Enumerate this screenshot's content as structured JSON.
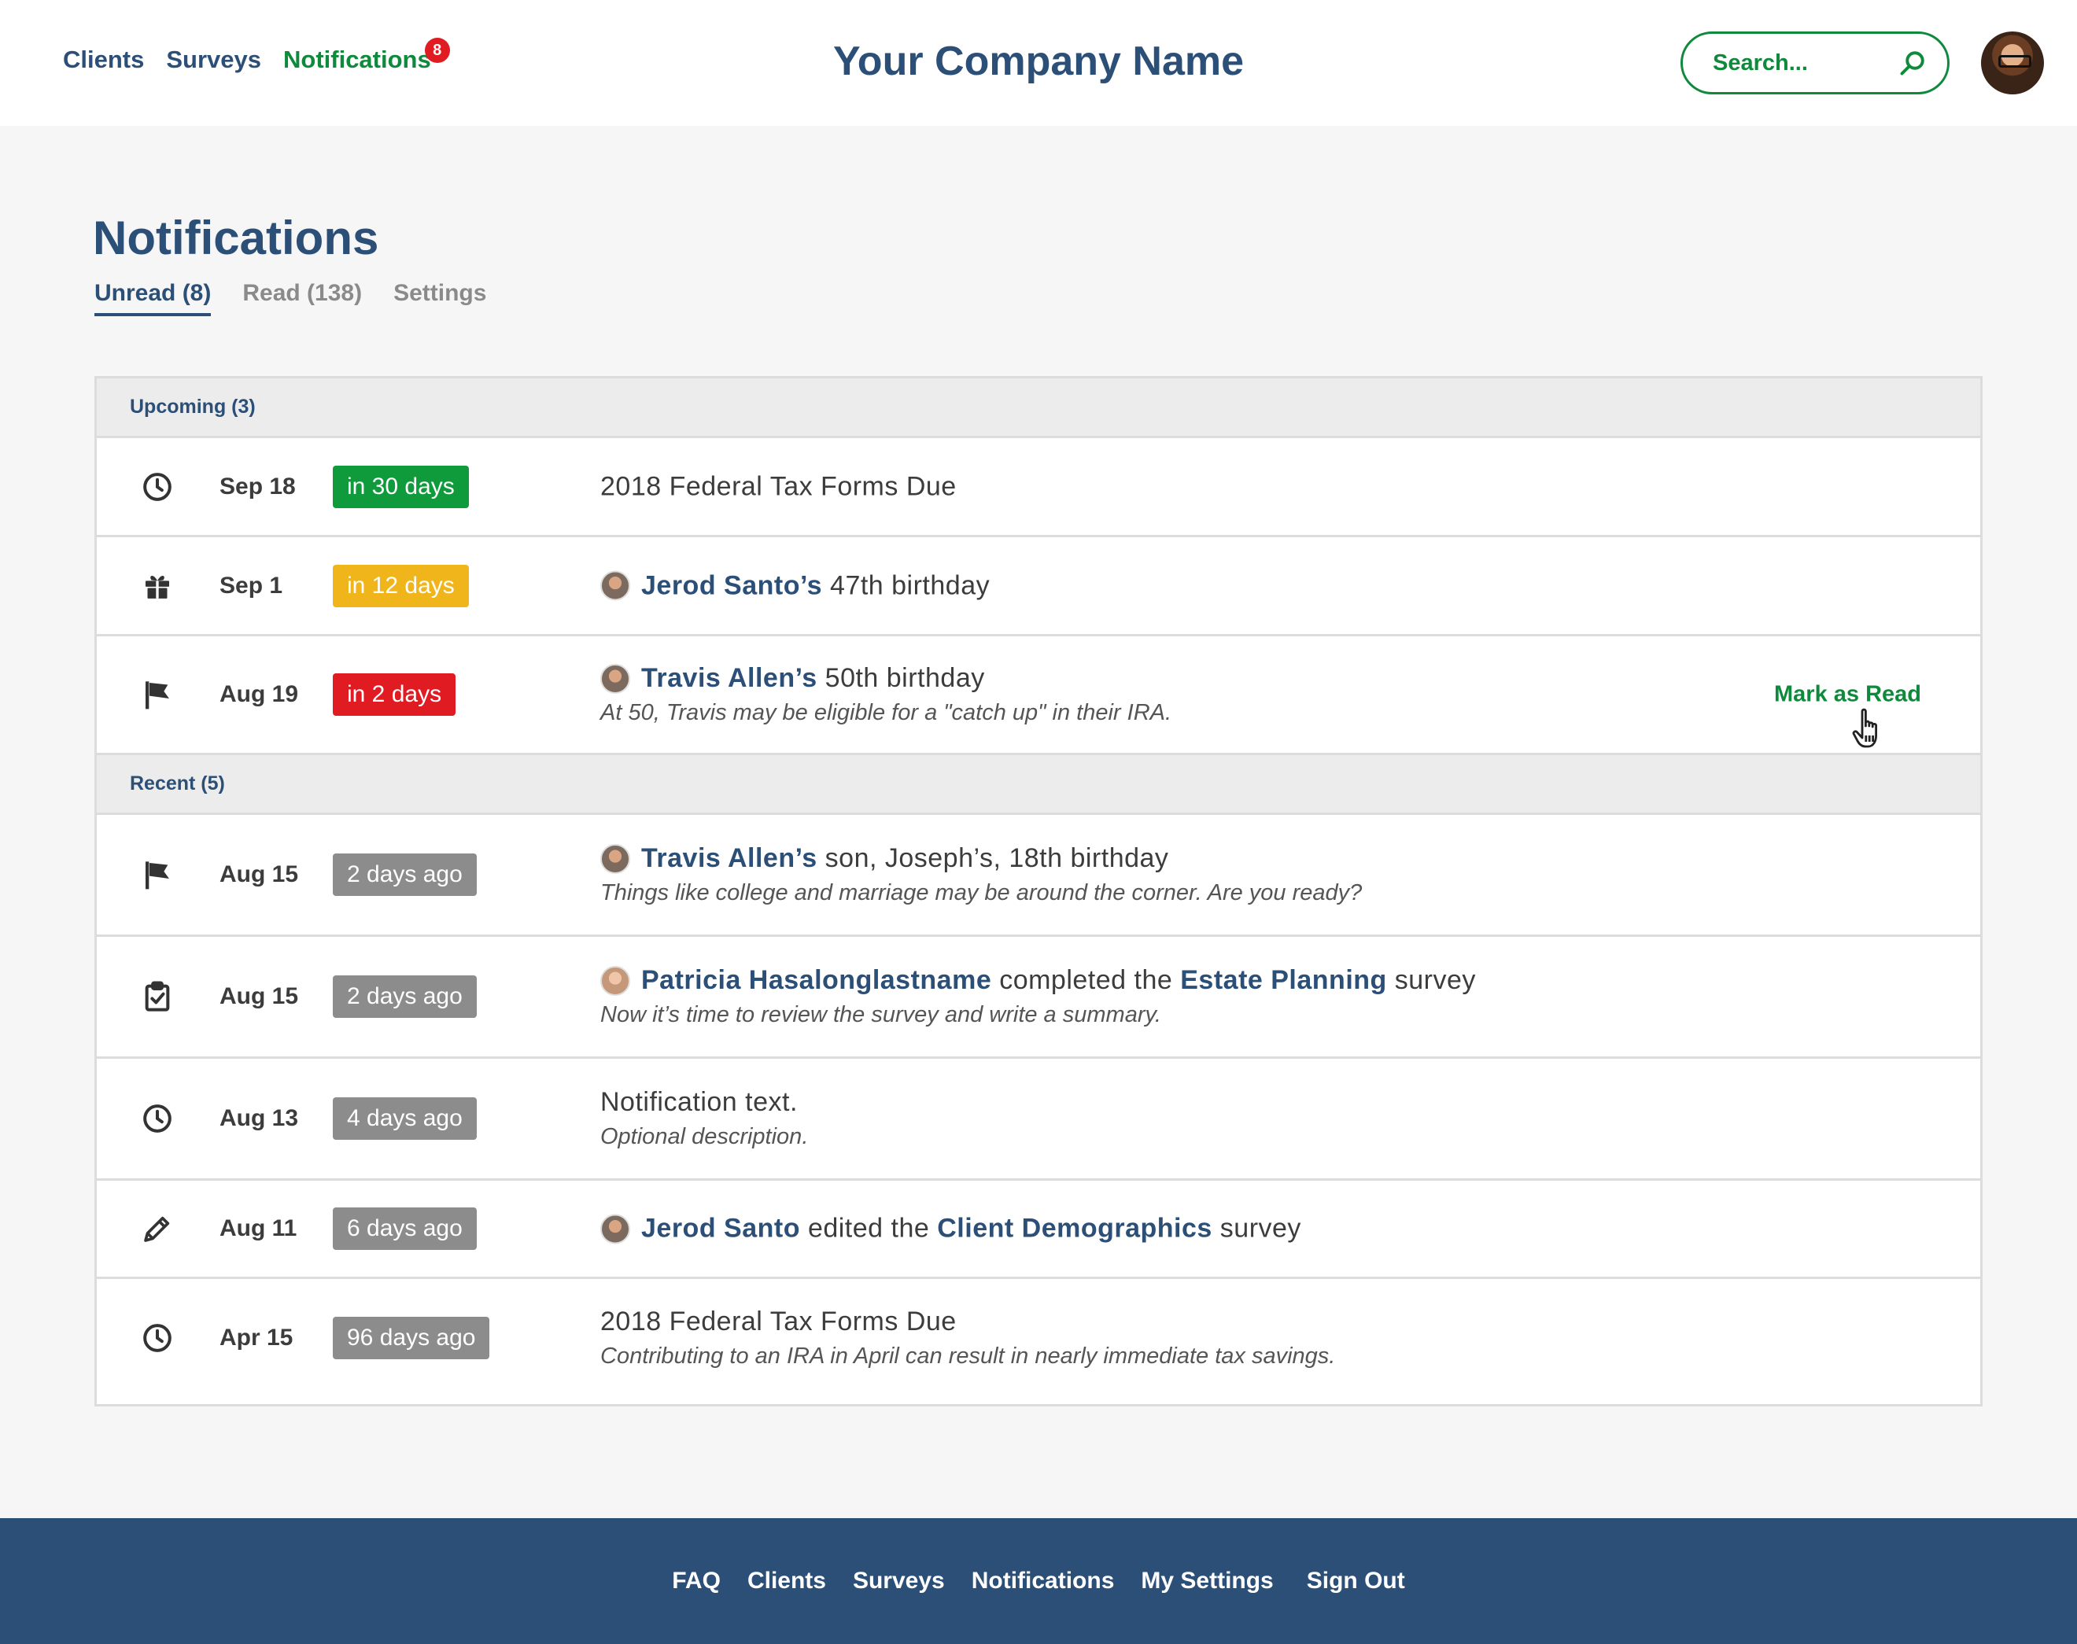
{
  "header": {
    "nav": [
      "Clients",
      "Surveys",
      "Notifications"
    ],
    "notification_count": "8",
    "brand": "Your Company Name",
    "search_placeholder": "Search...",
    "colors": {
      "primary": "#2c4f78",
      "accent": "#0f8a3c",
      "alert": "#e01b22"
    }
  },
  "page": {
    "title": "Notifications",
    "tabs": [
      "Unread (8)",
      "Read (138)",
      "Settings"
    ],
    "active_tab": "Unread (8)"
  },
  "groups": [
    {
      "heading": "Upcoming (3)",
      "items": [
        {
          "icon": "clock-icon",
          "date": "Sep 18",
          "pill": "in 30 days",
          "pill_color": "#0f9a3c",
          "text": "2018 Federal Tax Forms Due",
          "desc": ""
        },
        {
          "icon": "gift-icon",
          "date": "Sep 1",
          "pill": "in 12 days",
          "pill_color": "#f0b51a",
          "person": "Jerod Santo’s",
          "text": "47th birthday",
          "desc": ""
        },
        {
          "icon": "flag-icon",
          "date": "Aug 19",
          "pill": "in 2 days",
          "pill_color": "#e01b22",
          "person": "Travis Allen’s",
          "text": "50th birthday",
          "desc": "At 50, Travis may be eligible for a \"catch up\" in their IRA.",
          "action": "Mark as Read"
        }
      ]
    },
    {
      "heading": "Recent (5)",
      "items": [
        {
          "icon": "flag-icon",
          "date": "Aug 15",
          "pill": "2 days ago",
          "pill_color": "#8c8c8c",
          "person": "Travis Allen’s",
          "text": "son, Joseph’s, 18th birthday",
          "desc": "Things like college and marriage may be around the corner. Are you ready?"
        },
        {
          "icon": "clipboard-check-icon",
          "date": "Aug 15",
          "pill": "2 days ago",
          "pill_color": "#8c8c8c",
          "person": "Patricia Hasalonglastname",
          "text": "completed the",
          "survey": "Estate Planning",
          "suffix": "survey",
          "desc": "Now it’s time to review the survey and write a summary."
        },
        {
          "icon": "clock-icon",
          "date": "Aug 13",
          "pill": "4 days ago",
          "pill_color": "#8c8c8c",
          "text": "Notification text.",
          "desc": "Optional description."
        },
        {
          "icon": "pencil-icon",
          "date": "Aug 11",
          "pill": "6 days ago",
          "pill_color": "#8c8c8c",
          "person": "Jerod Santo",
          "text": "edited the",
          "survey": "Client Demographics",
          "suffix": "survey",
          "desc": ""
        },
        {
          "icon": "clock-icon",
          "date": "Apr 15",
          "pill": "96 days ago",
          "pill_color": "#8c8c8c",
          "text": "2018 Federal Tax Forms Due",
          "desc": "Contributing to an IRA in April can result in nearly immediate tax savings."
        }
      ]
    }
  ],
  "footer": {
    "links": [
      "FAQ",
      "Clients",
      "Surveys",
      "Notifications",
      "My Settings",
      "Sign Out"
    ]
  }
}
